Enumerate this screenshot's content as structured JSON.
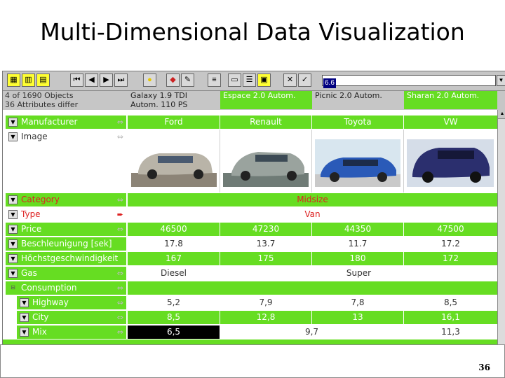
{
  "slide": {
    "title": "Multi-Dimensional Data Visualization",
    "page_number": "36"
  },
  "toolbar": {
    "zoom_value": "6.6"
  },
  "info": {
    "objects": "4 of 1690 Objects",
    "attributes": "36 Attributes differ"
  },
  "columns": [
    {
      "line1": "Galaxy 1.9 TDI",
      "line2": "Autom. 110 PS",
      "highlight": false
    },
    {
      "line1": "Espace 2.0 Autom.",
      "line2": "",
      "highlight": true
    },
    {
      "line1": "Picnic 2.0 Autom.",
      "line2": "",
      "highlight": false
    },
    {
      "line1": "Sharan 2.0 Autom.",
      "line2": "",
      "highlight": true
    }
  ],
  "rows": {
    "manufacturer": {
      "label": "Manufacturer",
      "values": [
        "Ford",
        "Renault",
        "Toyota",
        "VW"
      ]
    },
    "image": {
      "label": "Image"
    },
    "category": {
      "label": "Category",
      "value": "Midsize"
    },
    "type": {
      "label": "Type",
      "value": "Van"
    },
    "price": {
      "label": "Price",
      "values": [
        "46500",
        "47230",
        "44350",
        "47500"
      ]
    },
    "acceleration": {
      "label": "Beschleunigung [sek]",
      "values": [
        "17.8",
        "13.7",
        "11.7",
        "17.2"
      ]
    },
    "top_speed": {
      "label": "Höchstgeschwindigkeit",
      "values": [
        "167",
        "175",
        "180",
        "172"
      ]
    },
    "gas": {
      "label": "Gas",
      "value_ford": "Diesel",
      "value_others": "Super"
    },
    "consumption": {
      "label": "Consumption"
    },
    "highway": {
      "label": "Highway",
      "values": [
        "5,2",
        "7,9",
        "7,8",
        "8,5"
      ]
    },
    "city": {
      "label": "City",
      "values": [
        "8,5",
        "12,8",
        "13",
        "16,1"
      ]
    },
    "mix": {
      "label": "Mix",
      "value_ford": "6,5",
      "value_mid": "9,7",
      "value_vw": "11,3"
    }
  },
  "colors": {
    "green": "#66dd22",
    "red": "#dd2222",
    "toolbar_yellow": "#ffff33"
  },
  "car_colors": [
    "#b9b4a8",
    "#9aa39e",
    "#2a5ab8",
    "#2b2f6e"
  ]
}
